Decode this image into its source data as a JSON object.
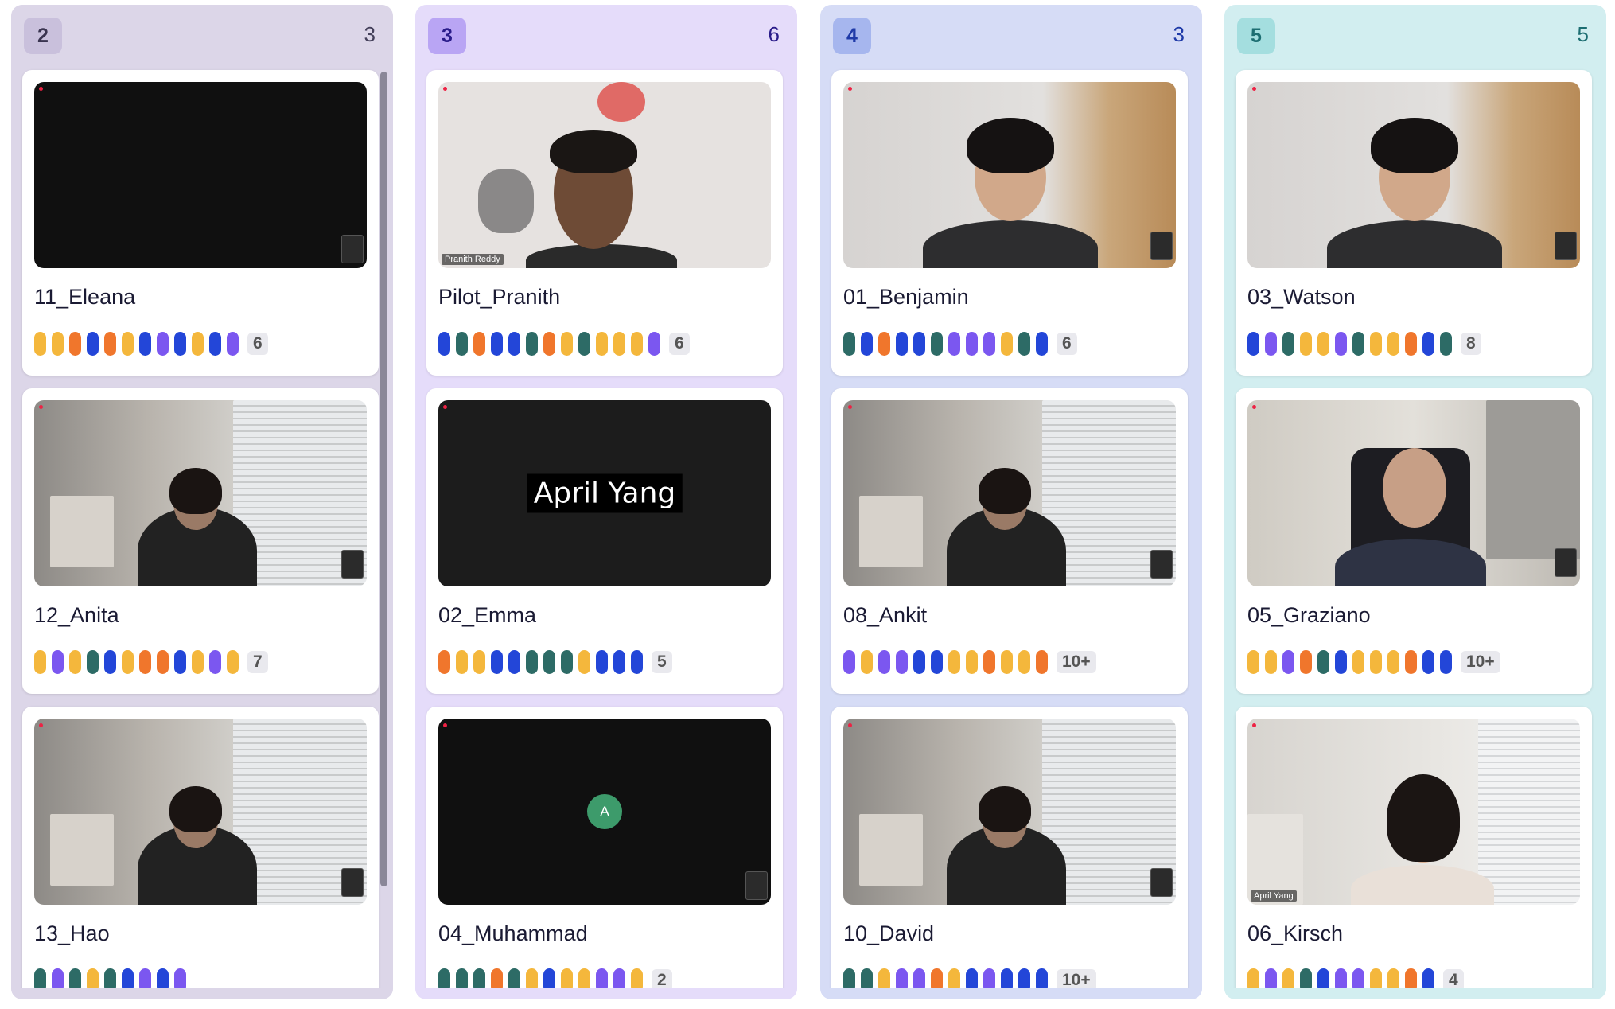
{
  "colors": {
    "yellow": "#f4b73c",
    "purple": "#7b57f0",
    "orange": "#f0762c",
    "blue": "#2346d8",
    "teal": "#2d6b66"
  },
  "columns": [
    {
      "number": "2",
      "count": "3",
      "bg": "#dcd6e8",
      "badge_bg": "#c9c0dc",
      "badge_fg": "#3a3450",
      "count_fg": "#44405a",
      "cards": [
        {
          "name": "11_Eleana",
          "scene": "black",
          "more": "6",
          "pills": [
            "yellow",
            "yellow",
            "orange",
            "blue",
            "orange",
            "yellow",
            "blue",
            "purple",
            "blue",
            "yellow",
            "blue",
            "purple"
          ]
        },
        {
          "name": "12_Anita",
          "scene": "room",
          "more": "7",
          "pills": [
            "yellow",
            "purple",
            "yellow",
            "teal",
            "blue",
            "yellow",
            "orange",
            "orange",
            "blue",
            "yellow",
            "purple",
            "yellow"
          ]
        },
        {
          "name": "13_Hao",
          "scene": "room",
          "more": "",
          "pills": [
            "teal",
            "purple",
            "teal",
            "yellow",
            "teal",
            "blue",
            "purple",
            "blue",
            "purple"
          ]
        }
      ]
    },
    {
      "number": "3",
      "count": "6",
      "bg": "#e5dcfa",
      "badge_bg": "#b9a5f4",
      "badge_fg": "#2a1c8a",
      "count_fg": "#2a1c8a",
      "cards": [
        {
          "name": "Pilot_Pranith",
          "scene": "pilot",
          "more": "6",
          "label": "Pranith Reddy",
          "pills": [
            "blue",
            "teal",
            "orange",
            "blue",
            "blue",
            "teal",
            "orange",
            "yellow",
            "teal",
            "yellow",
            "yellow",
            "yellow",
            "purple"
          ]
        },
        {
          "name": "02_Emma",
          "scene": "dark",
          "more": "5",
          "overlay": "April Yang",
          "pills": [
            "orange",
            "yellow",
            "yellow",
            "blue",
            "blue",
            "teal",
            "teal",
            "teal",
            "yellow",
            "blue",
            "blue",
            "blue"
          ]
        },
        {
          "name": "04_Muhammad",
          "scene": "black",
          "more": "2",
          "avatar": "A",
          "pills": [
            "teal",
            "teal",
            "teal",
            "orange",
            "teal",
            "yellow",
            "blue",
            "yellow",
            "yellow",
            "purple",
            "purple",
            "yellow"
          ]
        }
      ]
    },
    {
      "number": "4",
      "count": "3",
      "bg": "#d6dcf6",
      "badge_bg": "#a6b6ee",
      "badge_fg": "#1f3aa8",
      "count_fg": "#1f3aa8",
      "cards": [
        {
          "name": "01_Benjamin",
          "scene": "wall",
          "more": "6",
          "pills": [
            "teal",
            "blue",
            "orange",
            "blue",
            "blue",
            "teal",
            "purple",
            "purple",
            "purple",
            "yellow",
            "teal",
            "blue"
          ]
        },
        {
          "name": "08_Ankit",
          "scene": "room",
          "more": "10+",
          "pills": [
            "purple",
            "yellow",
            "purple",
            "purple",
            "blue",
            "blue",
            "yellow",
            "yellow",
            "orange",
            "yellow",
            "yellow",
            "orange"
          ]
        },
        {
          "name": "10_David",
          "scene": "room",
          "more": "10+",
          "pills": [
            "teal",
            "teal",
            "yellow",
            "purple",
            "purple",
            "orange",
            "yellow",
            "blue",
            "purple",
            "blue",
            "blue",
            "blue"
          ]
        }
      ]
    },
    {
      "number": "5",
      "count": "5",
      "bg": "#d2eef0",
      "badge_bg": "#a4dedf",
      "badge_fg": "#1d6e72",
      "count_fg": "#1d6e72",
      "cards": [
        {
          "name": "03_Watson",
          "scene": "wall",
          "more": "8",
          "pills": [
            "blue",
            "purple",
            "teal",
            "yellow",
            "yellow",
            "purple",
            "teal",
            "yellow",
            "yellow",
            "orange",
            "blue",
            "teal"
          ]
        },
        {
          "name": "05_Graziano",
          "scene": "office",
          "more": "10+",
          "pills": [
            "yellow",
            "yellow",
            "purple",
            "orange",
            "teal",
            "blue",
            "yellow",
            "yellow",
            "yellow",
            "orange",
            "blue",
            "blue"
          ]
        },
        {
          "name": "06_Kirsch",
          "scene": "kirsch",
          "more": "4",
          "label": "April Yang",
          "pills": [
            "yellow",
            "purple",
            "yellow",
            "teal",
            "blue",
            "purple",
            "purple",
            "yellow",
            "yellow",
            "orange",
            "blue"
          ]
        }
      ]
    }
  ]
}
